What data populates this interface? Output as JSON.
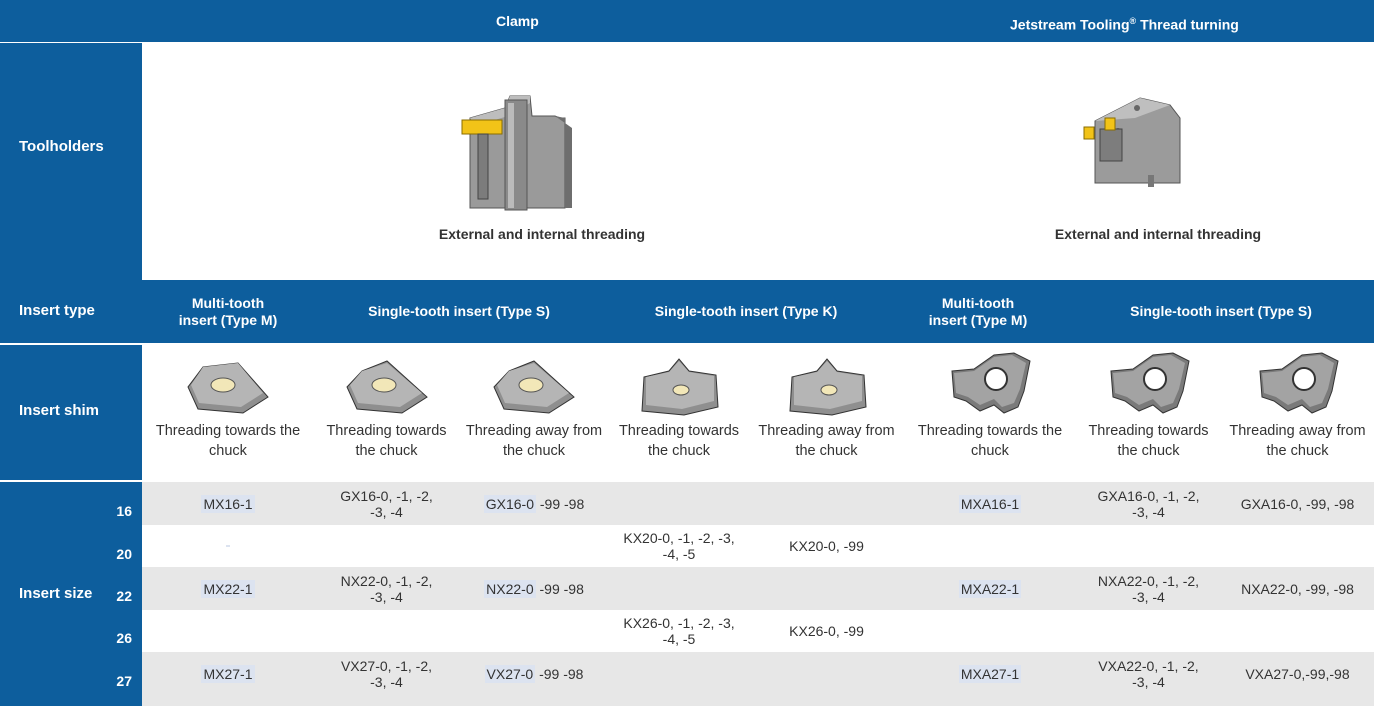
{
  "header": {
    "clamp_title": "Clamp",
    "jetstream_title": "Jetstream Tooling",
    "jetstream_reg": "®",
    "jetstream_suffix": " Thread turning"
  },
  "side": {
    "toolholders": "Toolholders",
    "insert_type": "Insert type",
    "insert_shim": "Insert shim",
    "insert_size": "Insert size"
  },
  "toolholders": {
    "clamp_caption": "External and internal threading",
    "jetstream_caption": "External and internal threading"
  },
  "insert_types": {
    "multi_tooth_m_1": "Multi-tooth",
    "multi_tooth_m_2": "insert (Type M)",
    "single_tooth_s": "Single-tooth insert (Type S)",
    "single_tooth_k": "Single-tooth insert (Type K)",
    "jet_multi_tooth_m_1": "Multi-tooth",
    "jet_multi_tooth_m_2": "insert (Type M)",
    "jet_single_tooth_s": "Single-tooth insert (Type S)"
  },
  "shims": [
    {
      "l1": "Threading towards the",
      "l2": "chuck"
    },
    {
      "l1": "Threading towards",
      "l2": "the chuck"
    },
    {
      "l1": "Threading away from",
      "l2": "the chuck"
    },
    {
      "l1": "Threading towards",
      "l2": "the chuck"
    },
    {
      "l1": "Threading away from",
      "l2": "the chuck"
    },
    {
      "l1": "Threading towards the",
      "l2": "chuck"
    },
    {
      "l1": "Threading towards",
      "l2": "the chuck"
    },
    {
      "l1": "Threading away from",
      "l2": "the chuck"
    }
  ],
  "sizes": [
    {
      "size": "16",
      "c1": "MX16-1",
      "c2a": "GX16-0, -1, -2,",
      "c2b": "-3, -4",
      "c3": "GX16-0",
      "c3s": " -99 -98",
      "c4a": "",
      "c4b": "",
      "c5": "",
      "c6": "MXA16-1",
      "c7a": "GXA16-0, -1, -2,",
      "c7b": "-3, -4",
      "c8": "GXA16-0, -99, -98"
    },
    {
      "size": "20",
      "c1": "",
      "c2a": "",
      "c2b": "",
      "c3": "",
      "c3s": "",
      "c4a": "KX20-0, -1, -2, -3,",
      "c4b": "-4, -5",
      "c5": "KX20-0, -99",
      "c6": "",
      "c7a": "",
      "c7b": "",
      "c8": ""
    },
    {
      "size": "22",
      "c1": "MX22-1",
      "c2a": "NX22-0, -1, -2,",
      "c2b": "-3, -4",
      "c3": "NX22-0",
      "c3s": " -99 -98",
      "c4a": "",
      "c4b": "",
      "c5": "",
      "c6": "MXA22-1",
      "c7a": "NXA22-0, -1, -2,",
      "c7b": "-3, -4",
      "c8": "NXA22-0, -99, -98"
    },
    {
      "size": "26",
      "c1": "",
      "c2a": "",
      "c2b": "",
      "c3": "",
      "c3s": "",
      "c4a": "KX26-0, -1, -2, -3,",
      "c4b": "-4, -5",
      "c5": "KX26-0, -99",
      "c6": "",
      "c7a": "",
      "c7b": "",
      "c8": ""
    },
    {
      "size": "27",
      "c1": "MX27-1",
      "c2a": "VX27-0, -1, -2,",
      "c2b": "-3, -4",
      "c3": "VX27-0",
      "c3s": " -99 -98",
      "c4a": "",
      "c4b": "",
      "c5": "",
      "c6": "MXA27-1",
      "c7a": "VXA22-0, -1, -2,",
      "c7b": "-3, -4",
      "c8": "VXA27-0,-99,-98"
    }
  ],
  "colors": {
    "header_blue": "#0d5e9d",
    "row_alt": "#e7e7e7",
    "highlight": "#dce3f0",
    "insert_yellow": "#f2c318"
  }
}
